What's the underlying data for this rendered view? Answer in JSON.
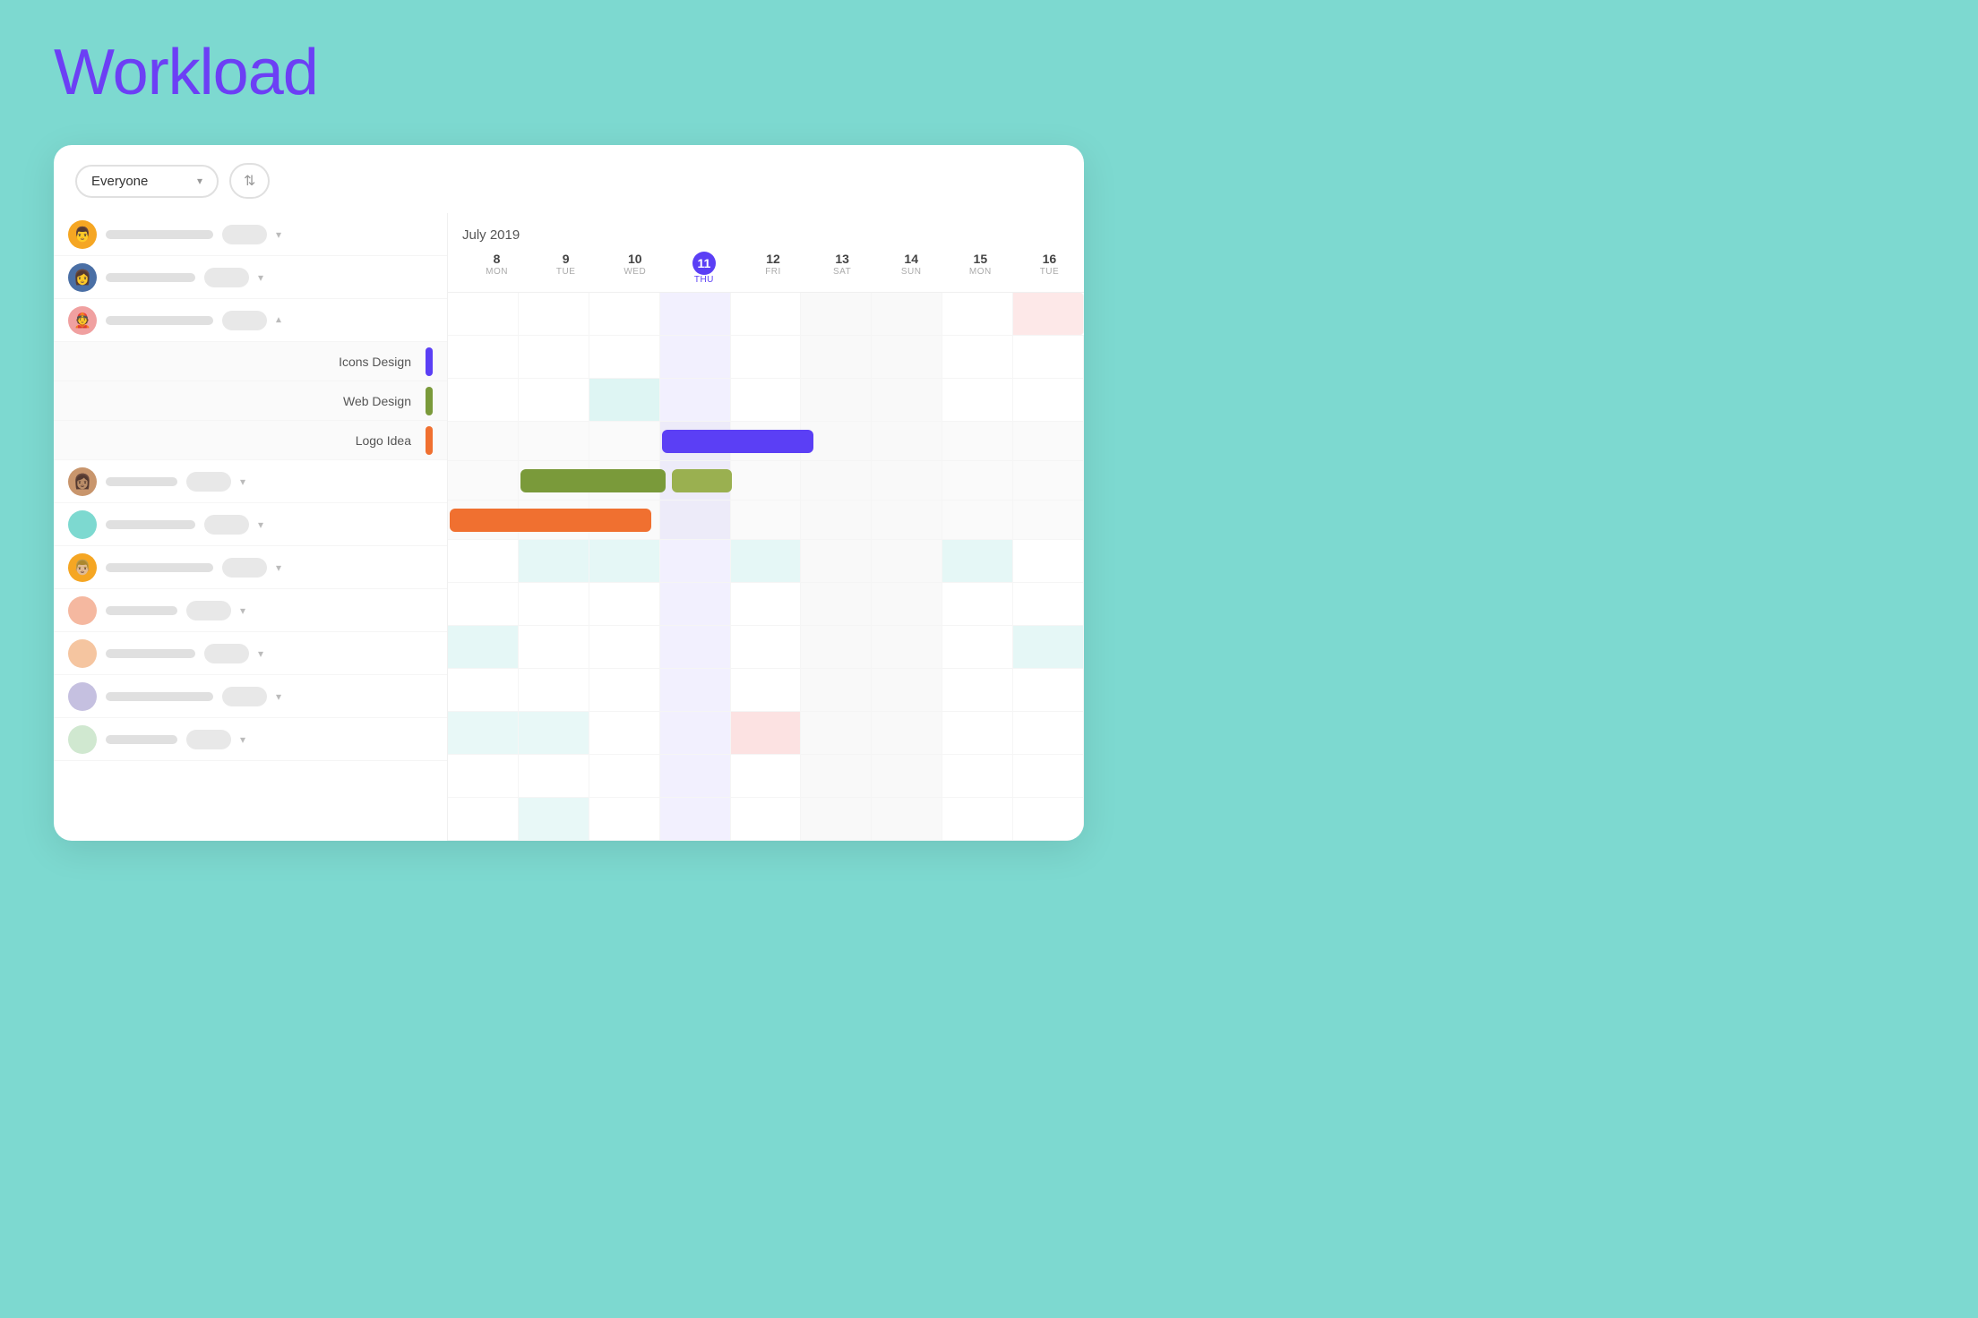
{
  "title": "Workload",
  "filter": {
    "label": "Everyone",
    "dropdown_icon": "▾",
    "sort_icon": "⇅"
  },
  "calendar": {
    "month_label": "July 2019",
    "days": [
      {
        "num": "8",
        "name": "MON",
        "today": false,
        "weekend": false
      },
      {
        "num": "9",
        "name": "TUE",
        "today": false,
        "weekend": false
      },
      {
        "num": "10",
        "name": "WED",
        "today": false,
        "weekend": false
      },
      {
        "num": "11",
        "name": "THU",
        "today": true,
        "weekend": false
      },
      {
        "num": "12",
        "name": "FRI",
        "today": false,
        "weekend": false
      },
      {
        "num": "13",
        "name": "SAT",
        "today": false,
        "weekend": true
      },
      {
        "num": "14",
        "name": "SUN",
        "today": false,
        "weekend": true
      },
      {
        "num": "15",
        "name": "MON",
        "today": false,
        "weekend": false
      },
      {
        "num": "16",
        "name": "TUE",
        "today": false,
        "weekend": false
      }
    ]
  },
  "tasks": [
    {
      "label": "Icons Design",
      "color": "purple"
    },
    {
      "label": "Web Design",
      "color": "olive"
    },
    {
      "label": "Logo Idea",
      "color": "orange"
    }
  ],
  "people": [
    {
      "avatar_color": "yellow",
      "avatar_emoji": "👨",
      "expanded": false
    },
    {
      "avatar_color": "blue",
      "avatar_emoji": "👩",
      "expanded": false
    },
    {
      "avatar_color": "pink",
      "avatar_emoji": "👲",
      "expanded": true
    },
    {
      "avatar_color": "brown",
      "avatar_emoji": "👩🏽",
      "expanded": false
    },
    {
      "avatar_color": "teal",
      "avatar_emoji": "●",
      "expanded": false
    },
    {
      "avatar_color": "orange",
      "avatar_emoji": "👨🏼",
      "expanded": false
    },
    {
      "avatar_color": "salmon",
      "avatar_emoji": "○",
      "expanded": false
    },
    {
      "avatar_color": "peach",
      "avatar_emoji": "○",
      "expanded": false
    },
    {
      "avatar_color": "lavender",
      "avatar_emoji": "○",
      "expanded": false
    },
    {
      "avatar_color": "green",
      "avatar_emoji": "○",
      "expanded": false
    }
  ]
}
